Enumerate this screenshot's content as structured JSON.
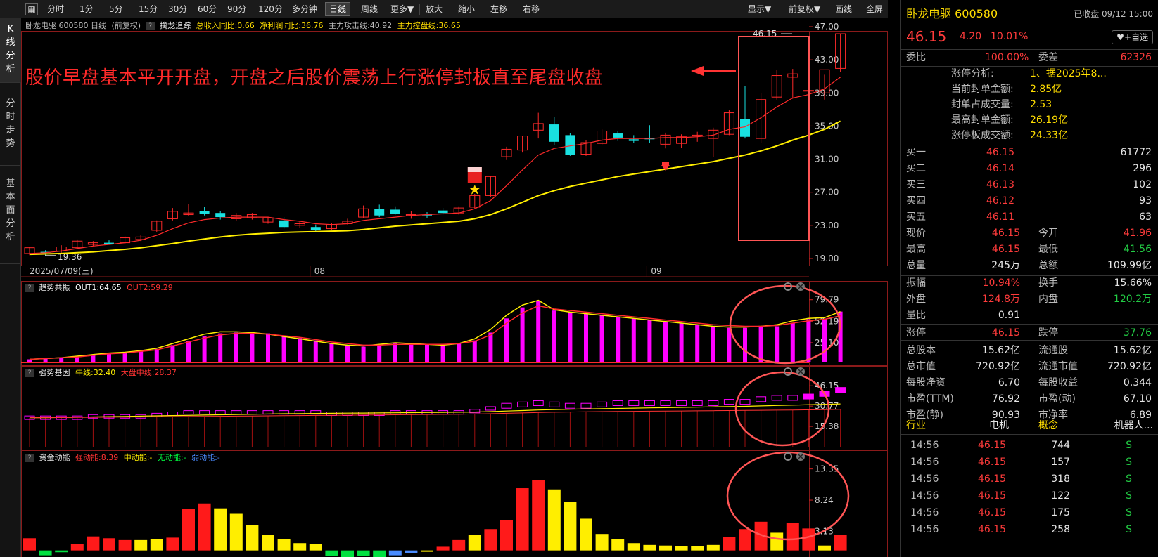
{
  "toolbar": {
    "periods": [
      "分时",
      "1分",
      "5分",
      "15分",
      "30分",
      "60分",
      "90分",
      "120分",
      "多分钟",
      "日线",
      "周线",
      "更多▼"
    ],
    "active": "日线",
    "actions": [
      "放大",
      "缩小",
      "左移",
      "右移"
    ],
    "right_menus": [
      "显示▼",
      "前复权▼",
      "画线",
      "全屏"
    ]
  },
  "side_tabs": [
    "K线分析",
    "分时走势",
    "基本面分析"
  ],
  "main_legend": {
    "stock": "卧龙电驱 600580 日线",
    "adjust": "(前复权)",
    "qmark": "?",
    "indicator": "擒龙追踪",
    "items": [
      {
        "text": "总收入同比:0.66",
        "color": "#ffdd00"
      },
      {
        "text": "净利润同比:36.76",
        "color": "#ffdd00"
      },
      {
        "text": "主力攻击线:40.92",
        "color": "#bbbbbb"
      },
      {
        "text": "主力控盘线:36.65",
        "color": "#ffdd00"
      }
    ]
  },
  "annotation": "股价早盘基本平开开盘，开盘之后股价震荡上行涨停封板直至尾盘收盘",
  "colors": {
    "up": "#ff2a2a",
    "down": "#19e0e0",
    "ma_fast": "#ff2a2a",
    "ma_slow": "#ffee00",
    "magenta": "#ff00ff",
    "yellow": "#ffee00",
    "green": "#00ff40",
    "blue": "#4a8cff",
    "highlight": "#ff5555"
  },
  "chart_data": [
    {
      "type": "candlestick",
      "title": "卧龙电驱 600580 日线",
      "x_labels": [
        "2025/07/09(三)",
        "08",
        "09"
      ],
      "yticks": [
        47.0,
        43.0,
        39.0,
        35.0,
        31.0,
        27.0,
        23.0,
        19.0
      ],
      "ylim": [
        19,
        47
      ],
      "min_label": "19.36",
      "max_label": "46.15",
      "ohlc": [
        [
          19.6,
          20.4,
          19.4,
          20.3
        ],
        [
          19.8,
          20.0,
          19.36,
          19.7
        ],
        [
          19.9,
          20.6,
          19.7,
          20.4
        ],
        [
          20.3,
          21.3,
          20.2,
          21.1
        ],
        [
          20.7,
          21.1,
          20.5,
          20.9
        ],
        [
          20.9,
          21.2,
          20.7,
          20.7
        ],
        [
          20.9,
          21.7,
          20.8,
          21.5
        ],
        [
          21.3,
          21.8,
          21.1,
          21.6
        ],
        [
          22.4,
          23.6,
          22.2,
          23.5
        ],
        [
          23.8,
          25.1,
          23.6,
          24.7
        ],
        [
          24.3,
          25.6,
          24.1,
          24.5
        ],
        [
          24.7,
          25.2,
          24.2,
          24.4
        ],
        [
          24.5,
          24.7,
          23.7,
          24.0
        ],
        [
          23.8,
          24.5,
          23.5,
          24.2
        ],
        [
          23.9,
          24.5,
          23.7,
          24.3
        ],
        [
          23.4,
          24.0,
          23.2,
          23.9
        ],
        [
          23.6,
          24.0,
          22.6,
          22.8
        ],
        [
          23.0,
          23.5,
          22.7,
          23.2
        ],
        [
          22.8,
          23.1,
          22.2,
          22.4
        ],
        [
          22.6,
          23.3,
          22.4,
          23.1
        ],
        [
          23.2,
          23.8,
          23.1,
          23.5
        ],
        [
          24.0,
          25.4,
          23.9,
          25.0
        ],
        [
          25.0,
          25.5,
          24.0,
          24.2
        ],
        [
          24.9,
          25.3,
          24.3,
          24.4
        ],
        [
          24.2,
          24.7,
          23.8,
          24.3
        ],
        [
          24.3,
          24.6,
          23.9,
          24.2
        ],
        [
          24.8,
          25.1,
          24.3,
          24.5
        ],
        [
          24.5,
          25.3,
          24.3,
          25.1
        ],
        [
          25.2,
          26.8,
          25.0,
          26.6
        ],
        [
          26.6,
          29.0,
          26.4,
          28.9
        ],
        [
          31.3,
          32.5,
          30.9,
          32.2
        ],
        [
          32.1,
          33.8,
          31.8,
          33.8
        ],
        [
          34.5,
          36.6,
          33.5,
          35.3
        ],
        [
          35.2,
          36.1,
          32.7,
          33.1
        ],
        [
          33.9,
          34.1,
          31.4,
          31.5
        ],
        [
          31.6,
          33.3,
          31.4,
          33.0
        ],
        [
          32.9,
          34.6,
          32.7,
          34.4
        ],
        [
          34.1,
          34.4,
          33.2,
          33.6
        ],
        [
          33.4,
          33.9,
          33.0,
          33.2
        ],
        [
          33.5,
          35.1,
          33.0,
          33.4
        ],
        [
          32.8,
          34.2,
          32.3,
          33.9
        ],
        [
          32.9,
          34.0,
          32.4,
          33.7
        ],
        [
          33.8,
          34.3,
          33.1,
          33.9
        ],
        [
          33.5,
          34.8,
          31.3,
          34.5
        ],
        [
          34.0,
          36.9,
          33.9,
          36.6
        ],
        [
          35.8,
          39.8,
          33.5,
          33.7
        ],
        [
          33.5,
          39.0,
          33.0,
          38.2
        ],
        [
          38.5,
          41.8,
          38.2,
          41.1
        ],
        [
          40.9,
          41.9,
          38.3,
          41.3
        ],
        [
          39.3,
          40.2,
          38.5,
          39.3
        ],
        [
          39.0,
          41.2,
          38.2,
          41.8
        ],
        [
          41.96,
          46.15,
          41.56,
          46.15
        ]
      ],
      "series": [
        {
          "values": [
            19.6,
            19.7,
            19.9,
            20.2,
            20.5,
            20.7,
            20.9,
            21.2,
            21.8,
            22.6,
            23.3,
            23.7,
            23.9,
            24.0,
            24.0,
            24.0,
            23.7,
            23.5,
            23.2,
            23.1,
            23.2,
            23.6,
            23.8,
            24.0,
            24.2,
            24.3,
            24.4,
            24.5,
            25.0,
            26.0,
            27.8,
            29.7,
            31.5,
            32.3,
            32.6,
            32.9,
            33.3,
            33.5,
            33.5,
            33.5,
            33.6,
            33.6,
            33.7,
            33.9,
            34.6,
            34.9,
            36.0,
            37.3,
            38.4,
            38.8,
            39.5,
            40.9
          ]
        },
        {
          "values": [
            19.5,
            19.55,
            19.6,
            19.7,
            19.8,
            19.95,
            20.1,
            20.3,
            20.55,
            20.8,
            21.1,
            21.35,
            21.6,
            21.8,
            21.95,
            22.05,
            22.15,
            22.2,
            22.25,
            22.3,
            22.35,
            22.5,
            22.7,
            22.9,
            23.05,
            23.2,
            23.35,
            23.5,
            23.8,
            24.3,
            25.0,
            25.8,
            26.6,
            27.2,
            27.7,
            28.1,
            28.5,
            28.9,
            29.2,
            29.5,
            29.8,
            30.1,
            30.4,
            30.7,
            31.1,
            31.5,
            32.0,
            32.6,
            33.3,
            33.9,
            34.6,
            35.6
          ]
        }
      ]
    },
    {
      "type": "bar",
      "title": "趋势共振",
      "legend": [
        {
          "name": "OUT1:64.65",
          "color": "#ffffff"
        },
        {
          "name": "OUT2:59.29",
          "color": "#ff3333"
        }
      ],
      "yticks": [
        79.79,
        52.19,
        25.1
      ],
      "ylim": [
        0,
        84
      ],
      "values": [
        4,
        5,
        6,
        8,
        10,
        12,
        13,
        15,
        17,
        22,
        27,
        33,
        37,
        38,
        38,
        37,
        34,
        31,
        28,
        24,
        22,
        20,
        22,
        25,
        24,
        23,
        22,
        24,
        28,
        38,
        56,
        70,
        78,
        66,
        64,
        62,
        60,
        58,
        56,
        54,
        52,
        50,
        48,
        46,
        44,
        44,
        45,
        46,
        50,
        55,
        55,
        64.65
      ],
      "line1": [
        4,
        5,
        6,
        8,
        10,
        12,
        13,
        15,
        18,
        24,
        30,
        36,
        39,
        39,
        38,
        36,
        33,
        30,
        27,
        24,
        22,
        21,
        23,
        25,
        24,
        23,
        22,
        24,
        30,
        42,
        60,
        73,
        79,
        67,
        64,
        62,
        60,
        58,
        56,
        54,
        52,
        50,
        48,
        46,
        45,
        45,
        46,
        48,
        53,
        56,
        57,
        64.65
      ],
      "line2": [
        4,
        5,
        6,
        7,
        9,
        11,
        12,
        14,
        16,
        21,
        26,
        31,
        35,
        37,
        37,
        36,
        34,
        32,
        29,
        26,
        24,
        22,
        22,
        23,
        23,
        23,
        23,
        24,
        27,
        35,
        50,
        63,
        72,
        68,
        66,
        64,
        62,
        60,
        58,
        56,
        54,
        52,
        50,
        48,
        47,
        46,
        46,
        47,
        50,
        53,
        55,
        59.29
      ]
    },
    {
      "type": "bar",
      "title": "强势基因",
      "legend": [
        {
          "name": "牛线:32.40",
          "color": "#ffee00"
        },
        {
          "name": "大盘中线:28.37",
          "color": "#ff3333"
        }
      ],
      "yticks": [
        46.15,
        30.77,
        15.38
      ],
      "ylim": [
        0,
        50
      ],
      "values": [
        22,
        22,
        22,
        22,
        23,
        23,
        23,
        23,
        24,
        25,
        26,
        26,
        26,
        26,
        26,
        26,
        26,
        26,
        26,
        25,
        25,
        25,
        25,
        26,
        26,
        26,
        26,
        26,
        27,
        29,
        31,
        32,
        33,
        32,
        31,
        31,
        32,
        33,
        33,
        33,
        33,
        33,
        33,
        33,
        34,
        34,
        36,
        37,
        37,
        38,
        40,
        43
      ],
      "line1": [
        22,
        22,
        22.2,
        22.4,
        22.6,
        22.8,
        23,
        23.2,
        23.4,
        23.6,
        23.8,
        24,
        24.2,
        24.4,
        24.6,
        24.8,
        25,
        25.1,
        25.2,
        25.3,
        25.4,
        25.5,
        25.6,
        25.7,
        25.8,
        25.9,
        26,
        26.1,
        26.3,
        26.6,
        27,
        27.4,
        27.8,
        28.1,
        28.4,
        28.6,
        28.8,
        29,
        29.2,
        29.4,
        29.6,
        29.8,
        30,
        30.2,
        30.4,
        30.6,
        30.9,
        31.2,
        31.5,
        31.8,
        32.1,
        32.4
      ],
      "line2": [
        22,
        22,
        22.1,
        22.2,
        22.3,
        22.4,
        22.5,
        22.6,
        22.7,
        22.8,
        22.9,
        23,
        23.1,
        23.2,
        23.3,
        23.4,
        23.5,
        23.6,
        23.7,
        23.8,
        23.9,
        24,
        24.1,
        24.2,
        24.3,
        24.4,
        24.5,
        24.6,
        24.8,
        25,
        25.3,
        25.6,
        25.9,
        26.1,
        26.3,
        26.5,
        26.6,
        26.7,
        26.8,
        26.9,
        27,
        27.1,
        27.2,
        27.3,
        27.4,
        27.5,
        27.6,
        27.7,
        27.8,
        27.9,
        28.1,
        28.37
      ]
    },
    {
      "type": "bar",
      "title": "资金动能",
      "legend": [
        {
          "name": "强动能:8.39",
          "color": "#ff3333"
        },
        {
          "name": "中动能:-",
          "color": "#ffee00"
        },
        {
          "name": "无动能:-",
          "color": "#00ff40"
        },
        {
          "name": "弱动能:-",
          "color": "#4a8cff"
        }
      ],
      "yticks": [
        13.35,
        8.24,
        3.13
      ],
      "ylim": [
        -0.5,
        14
      ],
      "values": [
        2.0,
        -0.8,
        -0.3,
        1.0,
        2.3,
        2.0,
        1.7,
        1.7,
        1.9,
        2.1,
        6.8,
        7.7,
        6.9,
        6.0,
        4.2,
        2.6,
        1.8,
        1.2,
        1.0,
        -0.9,
        -1.2,
        -0.9,
        -1.2,
        -0.8,
        -0.5,
        -0.1,
        0.6,
        1.7,
        2.6,
        3.5,
        5.0,
        10.2,
        11.5,
        10.0,
        8.0,
        5.2,
        2.7,
        1.8,
        1.2,
        0.9,
        0.8,
        0.7,
        0.7,
        0.9,
        2.2,
        3.5,
        4.7,
        2.9,
        4.5,
        3.6,
        0.8,
        2.6,
        8.39
      ],
      "colors": [
        "r",
        "g",
        "g",
        "r",
        "r",
        "r",
        "r",
        "y",
        "y",
        "r",
        "r",
        "r",
        "y",
        "y",
        "y",
        "y",
        "y",
        "y",
        "y",
        "g",
        "g",
        "g",
        "g",
        "b",
        "b",
        "y",
        "r",
        "r",
        "y",
        "r",
        "r",
        "r",
        "r",
        "y",
        "y",
        "y",
        "y",
        "y",
        "y",
        "y",
        "y",
        "y",
        "y",
        "y",
        "r",
        "r",
        "r",
        "y",
        "r",
        "r",
        "y",
        "r",
        "r"
      ]
    }
  ],
  "right_panel": {
    "title": "卧龙电驱 600580",
    "status": "已收盘 09/12 15:00",
    "price": "46.15",
    "change": "4.20",
    "change_pct": "10.01%",
    "watch_btn": "+自选",
    "weibi_label": "委比",
    "weibi": "100.00%",
    "weicha_label": "委差",
    "weicha": "62326",
    "limit_info": [
      {
        "label": "涨停分析:",
        "value": "1、据2025年8..."
      },
      {
        "label": "当前封单金额:",
        "value": "2.85亿"
      },
      {
        "label": "封单占成交量:",
        "value": "2.53"
      },
      {
        "label": "最高封单金额:",
        "value": "26.19亿"
      },
      {
        "label": "涨停板成交额:",
        "value": "24.33亿"
      }
    ],
    "bids": [
      {
        "label": "买一",
        "price": "46.15",
        "vol": "61772"
      },
      {
        "label": "买二",
        "price": "46.14",
        "vol": "296"
      },
      {
        "label": "买三",
        "price": "46.13",
        "vol": "102"
      },
      {
        "label": "买四",
        "price": "46.12",
        "vol": "93"
      },
      {
        "label": "买五",
        "price": "46.11",
        "vol": "63"
      }
    ],
    "stats": [
      {
        "l1": "现价",
        "v1": "46.15",
        "c1": "red",
        "l2": "今开",
        "v2": "41.96",
        "c2": "red"
      },
      {
        "l1": "最高",
        "v1": "46.15",
        "c1": "red",
        "l2": "最低",
        "v2": "41.56",
        "c2": "green"
      },
      {
        "l1": "总量",
        "v1": "245万",
        "c1": "white",
        "l2": "总额",
        "v2": "109.99亿",
        "c2": "white"
      },
      {
        "l1": "振幅",
        "v1": "10.94%",
        "c1": "red",
        "l2": "换手",
        "v2": "15.66%",
        "c2": "white"
      },
      {
        "l1": "外盘",
        "v1": "124.8万",
        "c1": "red",
        "l2": "内盘",
        "v2": "120.2万",
        "c2": "green"
      },
      {
        "l1": "量比",
        "v1": "0.91",
        "c1": "white",
        "l2": "",
        "v2": "",
        "c2": "white"
      },
      {
        "l1": "涨停",
        "v1": "46.15",
        "c1": "red",
        "l2": "跌停",
        "v2": "37.76",
        "c2": "green"
      },
      {
        "l1": "总股本",
        "v1": "15.62亿",
        "c1": "white",
        "l2": "流通股",
        "v2": "15.62亿",
        "c2": "white"
      },
      {
        "l1": "总市值",
        "v1": "720.92亿",
        "c1": "white",
        "l2": "流通市值",
        "v2": "720.92亿",
        "c2": "white"
      },
      {
        "l1": "每股净资",
        "v1": "6.70",
        "c1": "white",
        "l2": "每股收益",
        "v2": "0.344",
        "c2": "white"
      },
      {
        "l1": "市盈(TTM)",
        "v1": "76.92",
        "c1": "white",
        "l2": "市盈(动)",
        "v2": "67.10",
        "c2": "white"
      },
      {
        "l1": "市盈(静)",
        "v1": "90.93",
        "c1": "white",
        "l2": "市净率",
        "v2": "6.89",
        "c2": "white"
      }
    ],
    "industry_label": "行业",
    "industry": "电机",
    "concept_label": "概念",
    "concept": "机器人...",
    "ticks": [
      {
        "time": "14:56",
        "price": "46.15",
        "vol": "744",
        "flag": "S"
      },
      {
        "time": "14:56",
        "price": "46.15",
        "vol": "157",
        "flag": "S"
      },
      {
        "time": "14:56",
        "price": "46.15",
        "vol": "318",
        "flag": "S"
      },
      {
        "time": "14:56",
        "price": "46.15",
        "vol": "122",
        "flag": "S"
      },
      {
        "time": "14:56",
        "price": "46.15",
        "vol": "175",
        "flag": "S"
      },
      {
        "time": "14:56",
        "price": "46.15",
        "vol": "258",
        "flag": "S"
      }
    ]
  }
}
